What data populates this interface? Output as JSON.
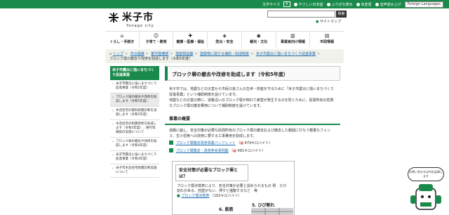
{
  "utility": {
    "items": [
      "文字サイズ",
      "やさしい日本語",
      "ふりがな表示",
      "色変更",
      "音声読み上げ"
    ],
    "text_size_box": "A",
    "language_button": "Foreign Languages"
  },
  "header": {
    "logo_text": "米子市",
    "logo_sub": "Yonago city",
    "search_button": "検索",
    "sitemap_link": "サイトマップ"
  },
  "nav": [
    {
      "label": "くらし・手続き",
      "icon": "house-icon"
    },
    {
      "label": "子育て・教育",
      "icon": "child-icon"
    },
    {
      "label": "健康・医療・福祉",
      "icon": "medical-icon"
    },
    {
      "label": "防災・安全",
      "icon": "shield-icon"
    },
    {
      "label": "観光・文化",
      "icon": "camera-icon"
    },
    {
      "label": "事業者向け情報",
      "icon": "building-icon"
    },
    {
      "label": "市政情報",
      "icon": "city-icon"
    }
  ],
  "breadcrumb": {
    "items": [
      "トップ",
      "市の組織",
      "都市整備部",
      "建築相談課",
      "建築物に関する補助・助成制度",
      "米子市震災に強いまちづくり促進事業"
    ],
    "current": "ブロック塀の撤去や改修を助成します（令和5年度）"
  },
  "sidebar": {
    "title": "米子市震災に強いまちづくり促進事業",
    "items": [
      "米子市震災に強いまちづくり促進事業（令和5年度）",
      "ブロック塀の撤去や改修を助成します（令和5年度）",
      "木造住宅の無料耐震診断を実施します（令和5年度）",
      "木造住宅の耐震改修を助成します（令和4年度）...要付等補助の実施について",
      "ブロック塀の撤去や改修を助成します（令和4年度）",
      "米子市震災に強いまちづくり促進事業（令和4年度）",
      "米子市木造住宅耐震診断実施について"
    ]
  },
  "main": {
    "title": "ブロック塀の撤去や改修を助成します（令和5年度）",
    "intro1": "米子市では、地震などの災害から市民の皆さんの生命・財産を守るために「米子市震災に強いまちづくり促進事業」という補助制度を設けています。",
    "intro2": "地震などの災害の際に、道路沿いのブロック塀が倒れて被害が発生するのを防ぐために、民間所有の危険なブロック塀の撤去費用について補助制度を設けています。",
    "section_title": "事業の概要",
    "section_text": "道路に面し、安全対策が必要な民間所有のブロック塀の撤去および撤去した範囲に行なう軽量なフェンス、生け垣等への改修に要する工事費用を助成します。",
    "downloads": [
      {
        "label": "ブロック塀撤去改修事業パンフレット",
        "size": "879キロバイト"
      },
      {
        "label": "ブロック塀撤去・改修参考事例集",
        "size": "481キロバイト"
      }
    ]
  },
  "info_box": {
    "title": "安全対策が必要なブロック塀とは？",
    "text": "ブロック塀点検表により、安全対策が必要と認められるもの 例　ひび割れがある、控壁がない、押すと揺動するなど　等",
    "link": "ブロック塀点検表",
    "link_size": "163キロバイト",
    "label_a": "6. 鉄筋",
    "label_b": "5. ひび割れ"
  },
  "mascot": {
    "bubble": "お問い合わせはAIお返事します"
  },
  "colors": {
    "brand_green": "#1a8a4a",
    "link_blue": "#1a6bb0"
  }
}
